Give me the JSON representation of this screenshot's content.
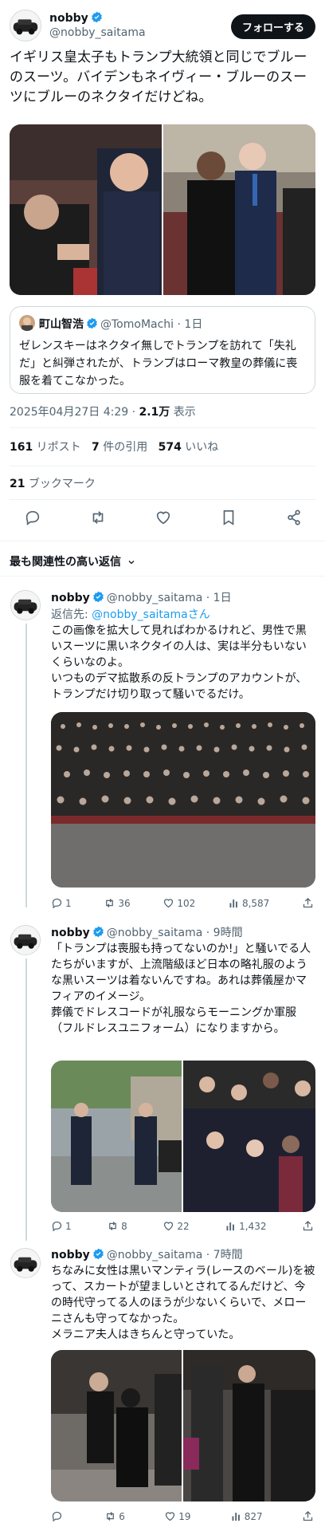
{
  "main_tweet": {
    "display_name": "nobby",
    "handle": "@nobby_saitama",
    "follow_label": "フォローする",
    "text": "イギリス皇太子もトランプ大統領と同じでブルーのスーツ。バイデンもネイヴィー・ブルーのスーツにブルーのネクタイだけどね。",
    "quote": {
      "display_name": "町山智浩",
      "handle": "@TomoMachi",
      "time": "· 1日",
      "text": "ゼレンスキーはネクタイ無しでトランプを訪れて「失礼だ」と糾弾されたが、トランプはローマ教皇の葬儀に喪服を着てこなかった。"
    },
    "timestamp": "2025年04月27日 4:29 · ",
    "views_count": "2.1万",
    "views_label": " 表示",
    "stats": {
      "reposts_count": "161",
      "reposts_label": " リポスト",
      "quotes_count": "7",
      "quotes_label": " 件の引用",
      "likes_count": "574",
      "likes_label": " いいね",
      "bookmarks_count": "21",
      "bookmarks_label": " ブックマーク"
    }
  },
  "sort_label": "最も関連性の高い返信",
  "replies": [
    {
      "display_name": "nobby",
      "handle": "@nobby_saitama",
      "time": "· 1日",
      "replying_to_prefix": "返信先: ",
      "replying_to": "@nobby_saitamaさん",
      "text": "この画像を拡大して見ればわかるけれど、男性で黒いスーツに黒いネクタイの人は、実は半分もいないくらいなのよ。\nいつものデマ拡散系の反トランプのアカウントが、トランプだけ切り取って騒いでるだけ。",
      "replies": "1",
      "reposts": "36",
      "likes": "102",
      "views": "8,587"
    },
    {
      "display_name": "nobby",
      "handle": "@nobby_saitama",
      "time": "· 9時間",
      "text": "「トランプは喪服も持ってないのか!」と騒いでる人たちがいますが、上流階級ほど日本の略礼服のような黒いスーツは着ないんですね。あれは葬儀屋かマフィアのイメージ。\n葬儀でドレスコードが礼服ならモーニングか軍服（フルドレスユニフォーム）になりますから。",
      "replies": "1",
      "reposts": "8",
      "likes": "22",
      "views": "1,432"
    },
    {
      "display_name": "nobby",
      "handle": "@nobby_saitama",
      "time": "· 7時間",
      "text": "ちなみに女性は黒いマンティラ(レースのベール)を被って、スカートが望ましいとされてるんだけど、今の時代守ってる人のほうが少ないくらいで、メローニさんも守ってなかった。\nメラニア夫人はきちんと守っていた。",
      "replies": "",
      "reposts": "6",
      "likes": "19",
      "views": "827"
    }
  ],
  "colors": {
    "accent": "#1d9bf0",
    "text": "#0f1419",
    "muted": "#536471",
    "border": "#cfd9de"
  }
}
